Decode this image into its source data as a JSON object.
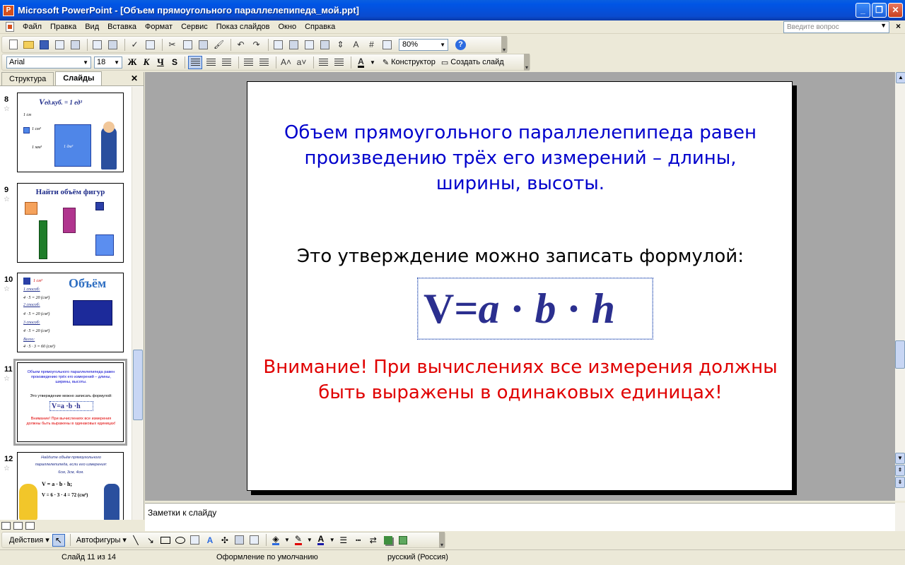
{
  "window": {
    "title": "Microsoft PowerPoint - [Объем прямоугольного параллелепипеда_мой.ppt]",
    "app_icon": "P"
  },
  "menu": {
    "items": [
      "Файл",
      "Правка",
      "Вид",
      "Вставка",
      "Формат",
      "Сервис",
      "Показ слайдов",
      "Окно",
      "Справка"
    ],
    "ask_placeholder": "Введите вопрос"
  },
  "toolbar_standard": {
    "zoom": "80%"
  },
  "toolbar_formatting": {
    "font": "Arial",
    "size": "18",
    "bold": "Ж",
    "italic": "К",
    "underline": "Ч",
    "shadow": "S",
    "font_color": "A",
    "design_label": "Конструктор",
    "new_slide_label": "Создать слайд"
  },
  "left_pane": {
    "tabs": [
      "Структура",
      "Слайды"
    ],
    "active_tab": "Слайды",
    "thumbnails": [
      {
        "number": "8",
        "title": "ед.куб. = 1 ед³",
        "title_v": "V",
        "labels": [
          "1 см",
          "1 см³",
          "1 мм³",
          "1 дм³"
        ]
      },
      {
        "number": "9",
        "title": "Найти объём фигур"
      },
      {
        "number": "10",
        "title": "Объём",
        "labels": [
          "1 см³",
          "1 способ:",
          "4 · 5 = 20 (см²)",
          "2 способ:",
          "4 · 5 = 20 (см²)",
          "3 способ:",
          "4 · 5 = 20 (см²)",
          "Всего:",
          "4 · 5 · 3 = 60 (см³)"
        ]
      },
      {
        "number": "11",
        "selected": true,
        "mini_title": "Объем прямоугольного параллелепипеда равен произведению трёх его измерений – длины, ширины, высоты.",
        "mini_sub": "Это утверждение можно записать формулой:",
        "mini_formula": "V=a ·b ·h",
        "mini_warn": "Внимание! При вычислениях все измерения должны быть выражены в одинаковых единицах!"
      },
      {
        "number": "12",
        "lines": [
          "Найдите объём прямоугольного",
          "параллелепипеда, если его измерения:",
          "6см, 3см, 4см.",
          "V = a · b · h;",
          "V = 6 · 3 · 4 = 72 (см³)"
        ]
      }
    ]
  },
  "slide": {
    "title": "Объем прямоугольного параллелепипеда равен произведению трёх его измерений – длины, ширины, высоты.",
    "subtitle": "Это утверждение можно записать формулой:",
    "formula": {
      "v": "V=",
      "a": "a",
      "dot1": " · ",
      "b": "b",
      "dot2": " · ",
      "h": "h"
    },
    "warning": "Внимание! При вычислениях все измерения должны быть выражены в одинаковых единицах!"
  },
  "notes": {
    "placeholder": "Заметки к слайду"
  },
  "drawing_toolbar": {
    "actions_label": "Действия",
    "autoshapes_label": "Автофигуры"
  },
  "status": {
    "slide": "Слайд 11 из 14",
    "design": "Оформление по умолчанию",
    "language": "русский (Россия)"
  },
  "colors": {
    "title_blue": "#0000cc",
    "warning_red": "#e00000",
    "formula_navy": "#2b2f8f"
  }
}
